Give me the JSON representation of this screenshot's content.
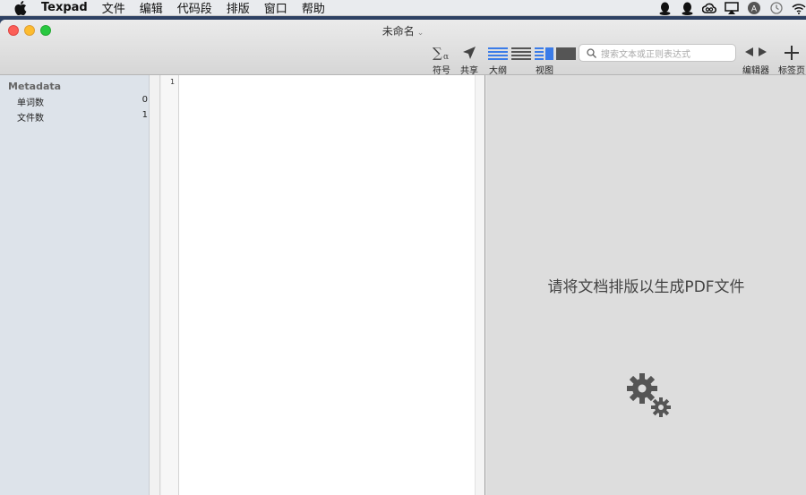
{
  "menubar": {
    "app_name": "Texpad",
    "items": [
      "文件",
      "编辑",
      "代码段",
      "排版",
      "窗口",
      "帮助"
    ],
    "status_icons": [
      "qq-icon",
      "qq-icon-2",
      "creative-cloud-icon",
      "airplay-icon",
      "user-circle-icon",
      "time-machine-icon",
      "wifi-icon"
    ]
  },
  "window": {
    "title": "未命名",
    "toolbar": {
      "symbols_label": "符号",
      "share_label": "共享",
      "outline_label": "大纲",
      "view_label": "视图",
      "search_placeholder": "搜索文本或正则表达式",
      "editor_label": "编辑器",
      "tab_label": "标签页"
    }
  },
  "sidebar": {
    "section_title": "Metadata",
    "rows": [
      {
        "label": "单词数",
        "value": "0"
      },
      {
        "label": "文件数",
        "value": "1"
      }
    ]
  },
  "editor": {
    "line_numbers": [
      "1"
    ]
  },
  "preview": {
    "message": "请将文档排版以生成PDF文件"
  },
  "colors": {
    "accent": "#3b7ce8",
    "sidebar_bg": "#dde3ea",
    "preview_bg": "#dddddd"
  }
}
